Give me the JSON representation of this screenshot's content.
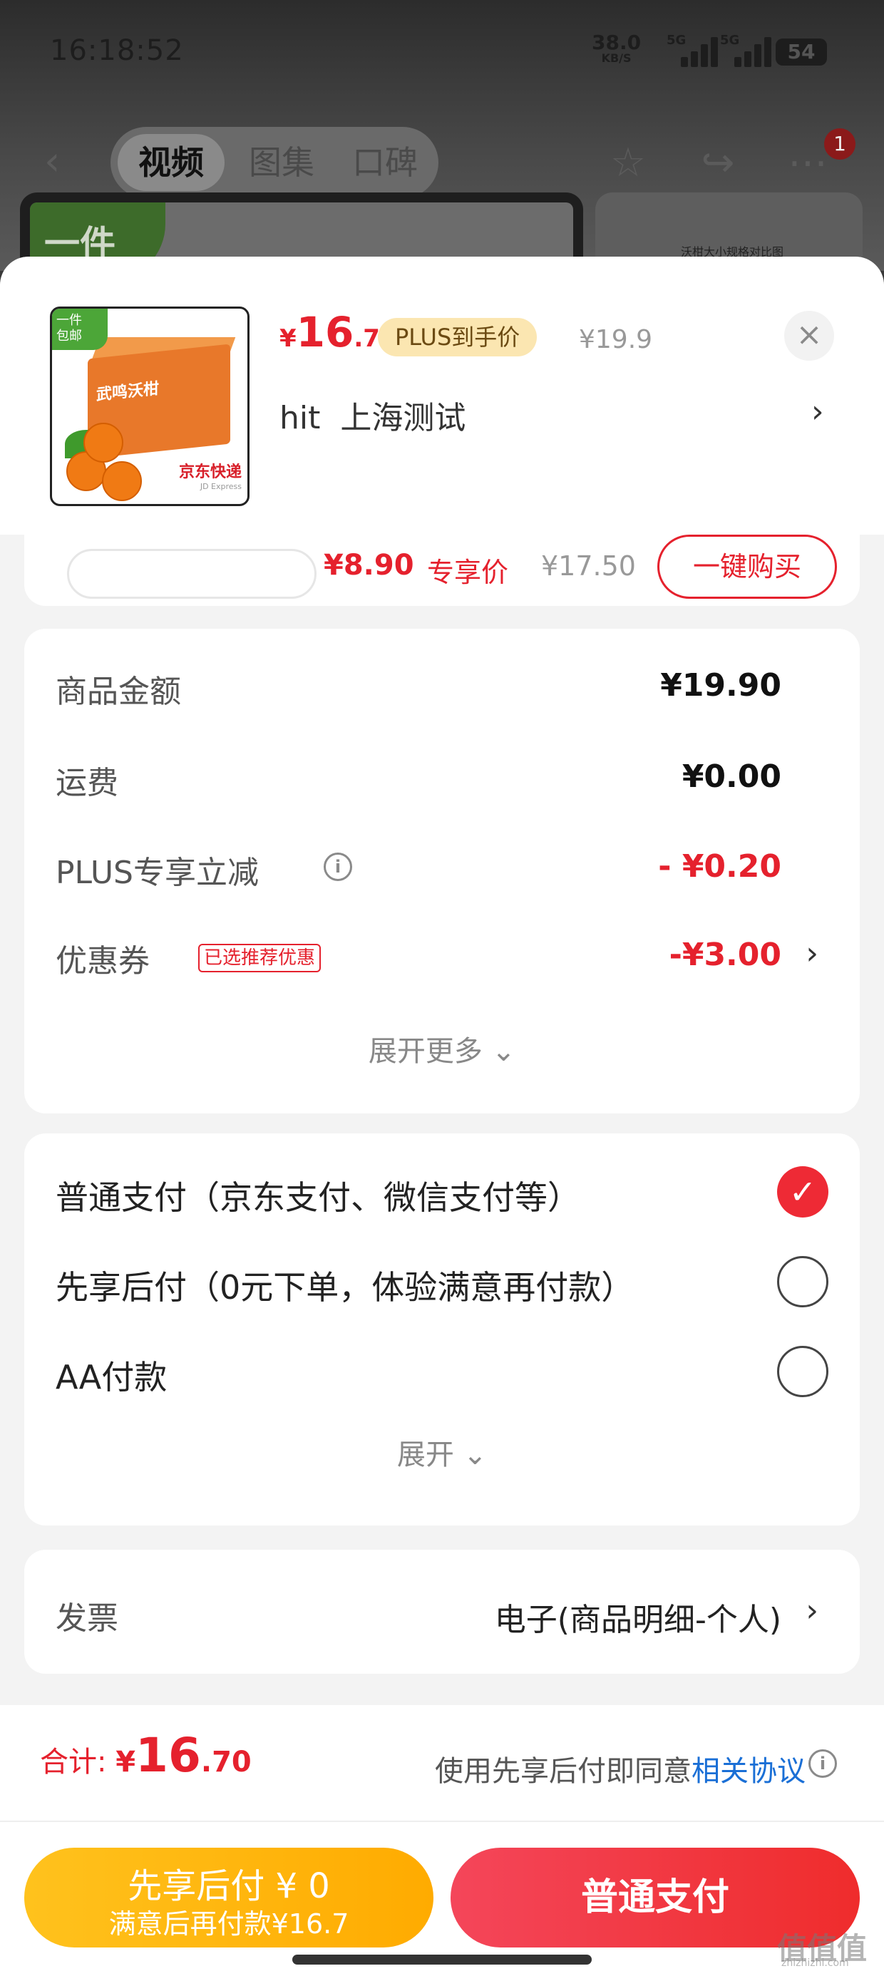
{
  "status_bar": {
    "time": "16:18:52",
    "net_speed": "38.0",
    "net_unit": "KB/S",
    "sim1": "5G",
    "sim2": "5G",
    "battery": "54"
  },
  "nav": {
    "tabs": [
      {
        "label": "视频",
        "active": true
      },
      {
        "label": "图集",
        "active": false
      },
      {
        "label": "口碑",
        "active": false
      }
    ],
    "badge": "1",
    "icons": [
      "back-icon",
      "star-icon",
      "share-icon",
      "more-icon"
    ]
  },
  "background_media": {
    "left_tag": "一件",
    "right_caption": "沃柑大小规格对比图"
  },
  "product": {
    "thumb_tag": "一件\n包邮",
    "thumb_box_text": "武鸣沃柑",
    "thumb_express": "京东快递",
    "thumb_express_en": "JD Express",
    "price_currency": "¥",
    "price_int": "16",
    "price_dec": ".7",
    "plus_tag": "PLUS到手价",
    "orig_price": "¥19.9",
    "address": "hit  上海测试",
    "address_chevron": "›",
    "close": "×"
  },
  "hidden_row": {
    "price": "¥8.90",
    "label": "专享价",
    "orig": "¥17.50",
    "button": "一键购买"
  },
  "price_breakdown": {
    "rows": [
      {
        "label": "商品金额",
        "value": "¥19.90"
      },
      {
        "label": "运费",
        "value": "¥0.00"
      },
      {
        "label": "PLUS专享立减",
        "value": "- ¥0.20"
      },
      {
        "label": "优惠券",
        "tag": "已选推荐优惠",
        "value": "-¥3.00",
        "chevron": "›"
      }
    ],
    "expand": "展开更多 ⌄"
  },
  "payment": {
    "options": [
      {
        "label": "普通支付（京东支付、微信支付等）",
        "checked": true
      },
      {
        "label": "先享后付（0元下单，体验满意再付款）",
        "checked": false
      },
      {
        "label": "AA付款",
        "checked": false
      }
    ],
    "expand": "展开 ⌄",
    "check_glyph": "✓"
  },
  "invoice": {
    "label": "发票",
    "value": "电子(商品明细-个人)",
    "chevron": "›"
  },
  "footer": {
    "total_label": "合计: ",
    "total_currency": "¥",
    "total_int": "16",
    "total_dec": ".70",
    "agree_text": "使用先享后付即同意",
    "agree_link": "相关协议",
    "btn_later_line1": "先享后付 ¥ 0",
    "btn_later_line2": "满意后再付款¥16.7",
    "btn_pay": "普通支付"
  },
  "watermark": {
    "text": "值值值",
    "sub": "zhizhizhi.com"
  },
  "colors": {
    "accent_red": "#e5212d",
    "plus_gold": "#fbe6b1",
    "later_yellow": "#ffb300",
    "link_blue": "#1a6fd6"
  }
}
